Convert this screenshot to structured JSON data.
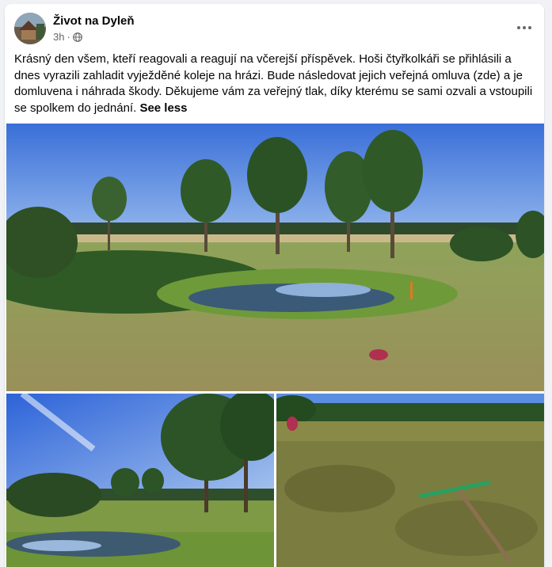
{
  "post": {
    "page_name": "Život na Dyleň",
    "time": "3h",
    "separator": "·",
    "privacy_icon": "globe-icon",
    "more_icon": "more-options-icon",
    "body_text": "Krásný den všem, kteří reagovali a reagují na včerejší příspěvek. Hoši čtyřkolkáři se přihlásili a dnes vyrazili zahladit vyježděné koleje na hrázi. Bude následovat jejich veřejná omluva (zde) a je domluvena i náhrada škody. Děkujeme vám za veřejný tlak, díky kterému se sami ozvali a vstoupili se spolkem do jednání.",
    "see_less_label": "See less"
  },
  "colors": {
    "background": "#f0f2f5",
    "card": "#ffffff",
    "text_primary": "#050505",
    "text_secondary": "#65676b"
  }
}
